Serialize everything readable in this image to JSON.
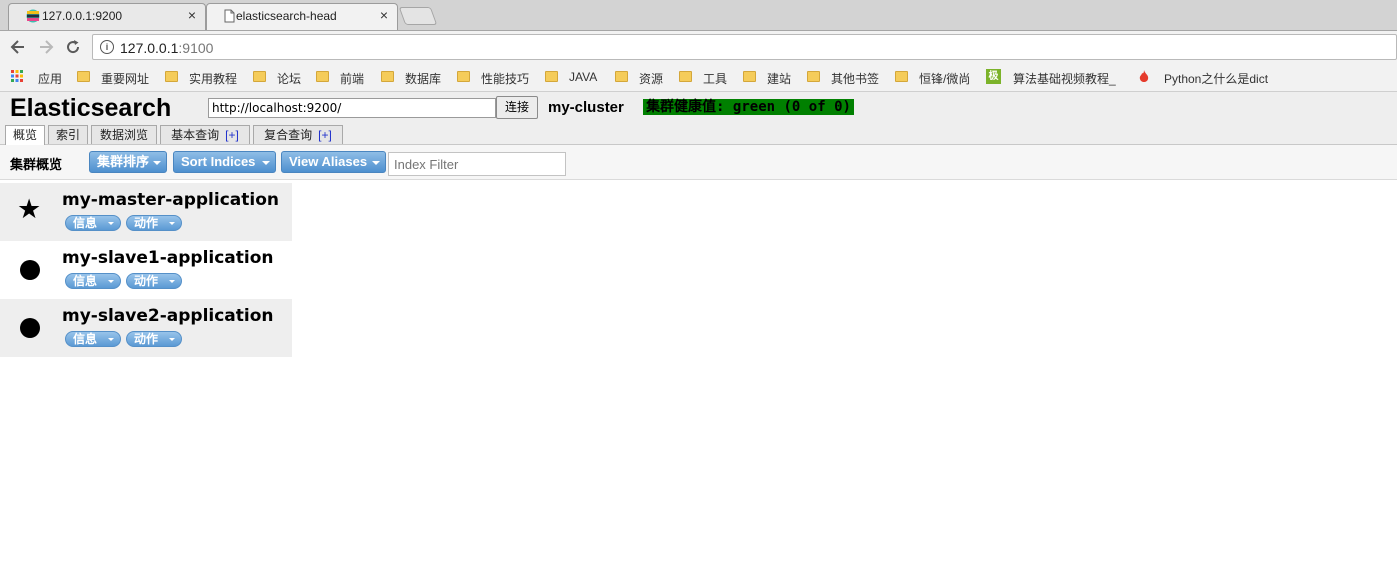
{
  "browser": {
    "tabs": [
      {
        "title": "127.0.0.1:9200",
        "icon": "elastic-logo-icon",
        "active": false
      },
      {
        "title": "elasticsearch-head",
        "icon": "document-icon",
        "active": true
      }
    ],
    "close_glyph": "×",
    "address": {
      "host": "127.0.0.1",
      "port": ":9100"
    },
    "bookmarks": [
      {
        "label": "应用",
        "icon": "apps-grid-icon"
      },
      {
        "label": "重要网址",
        "icon": "folder-icon"
      },
      {
        "label": "实用教程",
        "icon": "folder-icon"
      },
      {
        "label": "论坛",
        "icon": "folder-icon"
      },
      {
        "label": "前端",
        "icon": "folder-icon"
      },
      {
        "label": "数据库",
        "icon": "folder-icon"
      },
      {
        "label": "性能技巧",
        "icon": "folder-icon"
      },
      {
        "label": "JAVA",
        "icon": "folder-icon"
      },
      {
        "label": "资源",
        "icon": "folder-icon"
      },
      {
        "label": "工具",
        "icon": "folder-icon"
      },
      {
        "label": "建站",
        "icon": "folder-icon"
      },
      {
        "label": "其他书签",
        "icon": "folder-icon"
      },
      {
        "label": "恒锋/微尚",
        "icon": "folder-icon"
      },
      {
        "label": "算法基础视频教程_",
        "icon": "green-site-icon"
      },
      {
        "label": "Python之什么是dict",
        "icon": "flame-icon"
      }
    ]
  },
  "eshead": {
    "brand": "Elasticsearch",
    "url_value": "http://localhost:9200/",
    "connect_label": "连接",
    "cluster_name": "my-cluster",
    "health_text": "集群健康值: green (0 of 0)",
    "health_color": "#008000",
    "tabs": [
      {
        "label": "概览",
        "plus": ""
      },
      {
        "label": "索引",
        "plus": ""
      },
      {
        "label": "数据浏览",
        "plus": ""
      },
      {
        "label": "基本查询",
        "plus": "[+]"
      },
      {
        "label": "复合查询",
        "plus": "[+]"
      }
    ]
  },
  "overview": {
    "title": "集群概览",
    "sort_cluster_label": "集群排序",
    "sort_indices_label": "Sort Indices",
    "view_aliases_label": "View Aliases",
    "filter_placeholder": "Index Filter",
    "nodes": [
      {
        "name": "my-master-application",
        "icon": "star-icon",
        "info_label": "信息",
        "action_label": "动作"
      },
      {
        "name": "my-slave1-application",
        "icon": "dot-icon",
        "info_label": "信息",
        "action_label": "动作"
      },
      {
        "name": "my-slave2-application",
        "icon": "dot-icon",
        "info_label": "信息",
        "action_label": "动作"
      }
    ]
  }
}
